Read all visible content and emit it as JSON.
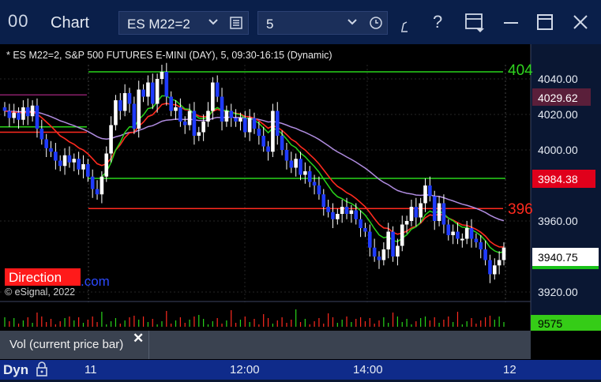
{
  "window": {
    "logo": "00",
    "title": "Chart",
    "symbol": "ES M22=2",
    "interval": "5"
  },
  "chart": {
    "header": "* ES M22=2, S&P 500 FUTURES E-MINI (DAY), 5, 09:30-16:15 (Dynamic)",
    "copyright": "© eSignal, 2022",
    "direction_label": "Direction",
    "com_label": ".com",
    "green_line_label": "404",
    "red_line_label": "396",
    "price_ticks": [
      "4040.00",
      "4020.00",
      "4000.00",
      "3960.00",
      "3920.00"
    ],
    "last_price": "3940.75",
    "red_level_price": "3984.38",
    "purple_level_price": "4029.62",
    "volume_value": "9575",
    "volume_study_label": "Vol (current price bar)",
    "time_labels": [
      "11",
      "12:00",
      "14:00",
      "12"
    ],
    "dyn_label": "Dyn"
  },
  "chart_data": {
    "type": "candlestick",
    "ylim": [
      3910,
      4060
    ],
    "y_ticks": [
      4040,
      4020,
      4000,
      3960,
      3920
    ],
    "x_labels": [
      "11",
      "12:00",
      "14:00",
      "12"
    ],
    "levels": {
      "green_upper": 4044,
      "green_lower": 3984,
      "red": 3967
    },
    "closes": [
      4022,
      4018,
      4021,
      4017,
      4024,
      4019,
      4025,
      4012,
      4006,
      4001,
      3999,
      3994,
      3991,
      3997,
      3993,
      3995,
      3989,
      3992,
      3985,
      3978,
      3975,
      3985,
      3998,
      4014,
      4028,
      4022,
      4032,
      4026,
      4012,
      4034,
      4030,
      4038,
      4026,
      4040,
      4044,
      4030,
      4022,
      4024,
      4016,
      4014,
      4022,
      4008,
      4010,
      4016,
      4022,
      4038,
      4030,
      4016,
      4022,
      4018,
      4016,
      4018,
      4010,
      4018,
      4012,
      4008,
      4002,
      3999,
      4022,
      4008,
      4000,
      3994,
      3990,
      3995,
      3986,
      3988,
      3982,
      3980,
      3975,
      3968,
      3965,
      3961,
      3964,
      3968,
      3964,
      3966,
      3961,
      3956,
      3954,
      3945,
      3940,
      3938,
      3944,
      3954,
      3940,
      3946,
      3958,
      3960,
      3968,
      3962,
      3970,
      3980,
      3974,
      3960,
      3970,
      3958,
      3952,
      3954,
      3950,
      3950,
      3956,
      3950,
      3948,
      3944,
      3938,
      3930,
      3935,
      3938,
      3945
    ]
  }
}
